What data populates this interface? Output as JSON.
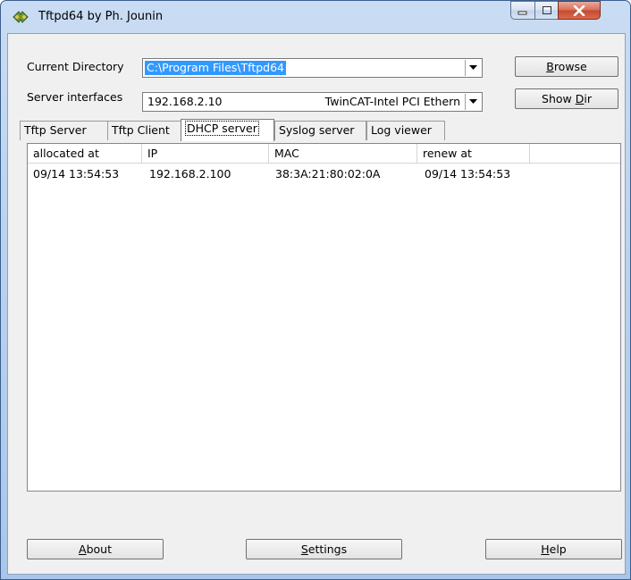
{
  "window": {
    "title": "Tftpd64 by Ph. Jounin",
    "icon": "tftpd-app-icon"
  },
  "current_directory": {
    "label": "Current Directory",
    "value": "C:\\Program Files\\Tftpd64"
  },
  "server_interfaces": {
    "label": "Server interfaces",
    "ip": "192.168.2.10",
    "adapter": "TwinCAT-Intel PCI Ethern"
  },
  "buttons": {
    "browse_prefix": "",
    "browse_ul": "B",
    "browse_rest": "rowse",
    "showdir_prefix": "Show ",
    "showdir_ul": "D",
    "showdir_rest": "ir",
    "about_ul": "A",
    "about_rest": "bout",
    "settings_ul": "S",
    "settings_rest": "ettings",
    "help_ul": "H",
    "help_rest": "elp"
  },
  "tabs": [
    {
      "label": "Tftp Server"
    },
    {
      "label": "Tftp Client"
    },
    {
      "label": "DHCP server",
      "active": true
    },
    {
      "label": "Syslog server"
    },
    {
      "label": "Log viewer"
    }
  ],
  "table": {
    "columns": [
      "allocated at",
      "IP",
      "MAC",
      "renew at"
    ],
    "rows": [
      [
        "09/14 13:54:53",
        "192.168.2.100",
        "38:3A:21:80:02:0A",
        "09/14 13:54:53"
      ]
    ]
  }
}
